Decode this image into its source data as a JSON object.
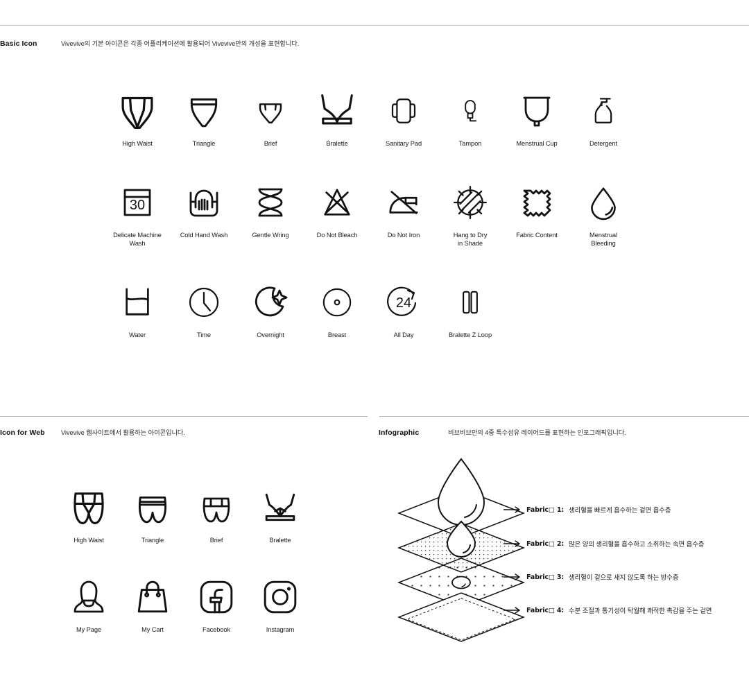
{
  "sections": {
    "basic": {
      "title": "Basic Icon",
      "desc": "Vivevive의 기본 아이콘은 각종 어플리케이션에 활용되어 Vivevive만의 개성을 표현합니다."
    },
    "web": {
      "title": "Icon for Web",
      "desc": "Vivevive 웹사이트에서 활용하는 아이콘입니다."
    },
    "infographic": {
      "title": "Infographic",
      "desc": "비브비브만의 4중 특수섬유 레이어드를 표현하는 인포그래픽입니다."
    }
  },
  "basic_icons": [
    {
      "name": "high-waist-icon",
      "label": "High Waist"
    },
    {
      "name": "triangle-icon",
      "label": "Triangle"
    },
    {
      "name": "brief-icon",
      "label": "Brief"
    },
    {
      "name": "bralette-icon",
      "label": "Bralette"
    },
    {
      "name": "sanitary-pad-icon",
      "label": "Sanitary Pad"
    },
    {
      "name": "tampon-icon",
      "label": "Tampon"
    },
    {
      "name": "menstrual-cup-icon",
      "label": "Menstrual Cup"
    },
    {
      "name": "detergent-icon",
      "label": "Detergent"
    },
    {
      "name": "delicate-machine-wash-icon",
      "label": "Delicate Machine\nWash"
    },
    {
      "name": "cold-hand-wash-icon",
      "label": "Cold Hand Wash"
    },
    {
      "name": "gentle-wring-icon",
      "label": "Gentle  Wring"
    },
    {
      "name": "do-not-bleach-icon",
      "label": "Do Not Bleach"
    },
    {
      "name": "do-not-iron-icon",
      "label": "Do Not Iron"
    },
    {
      "name": "hang-to-dry-in-shade-icon",
      "label": "Hang to Dry\nin Shade"
    },
    {
      "name": "fabric-content-icon",
      "label": "Fabric Content"
    },
    {
      "name": "menstrual-bleeding-icon",
      "label": "Menstrual\nBleeding"
    },
    {
      "name": "water-icon",
      "label": "Water"
    },
    {
      "name": "time-icon",
      "label": "Time"
    },
    {
      "name": "overnight-icon",
      "label": "Overnight"
    },
    {
      "name": "breast-icon",
      "label": "Breast"
    },
    {
      "name": "all-day-icon",
      "label": "All Day"
    },
    {
      "name": "bralette-z-loop-icon",
      "label": "Bralette Z Loop"
    }
  ],
  "icon_values": {
    "machine_wash_temp": "30",
    "all_day_hours": "24"
  },
  "web_icons": [
    {
      "name": "web-high-waist-icon",
      "label": "High Waist"
    },
    {
      "name": "web-triangle-icon",
      "label": "Triangle"
    },
    {
      "name": "web-brief-icon",
      "label": "Brief"
    },
    {
      "name": "web-bralette-icon",
      "label": "Bralette"
    },
    {
      "name": "my-page-icon",
      "label": "My Page"
    },
    {
      "name": "my-cart-icon",
      "label": "My Cart"
    },
    {
      "name": "facebook-icon",
      "label": "Facebook"
    },
    {
      "name": "instagram-icon",
      "label": "Instagram"
    }
  ],
  "infographic_layers": [
    {
      "label": "Fabric□ 1:",
      "text": "생리혈을 빠르게 흡수하는 겉면 흡수층"
    },
    {
      "label": "Fabric□ 2:",
      "text": "많은 양의 생리혈을 흡수하고 소취하는 속면 흡수층"
    },
    {
      "label": "Fabric□ 3:",
      "text": "생리혈이 겉으로 새지 않도록 하는 방수층"
    },
    {
      "label": "Fabric□ 4:",
      "text": "수분 조절과 통기성이 탁월해 쾌적한 촉감을 주는 겉면"
    }
  ],
  "colors": {
    "ink": "#121212",
    "rule": "#b9b9b9",
    "background": "#ffffff"
  }
}
